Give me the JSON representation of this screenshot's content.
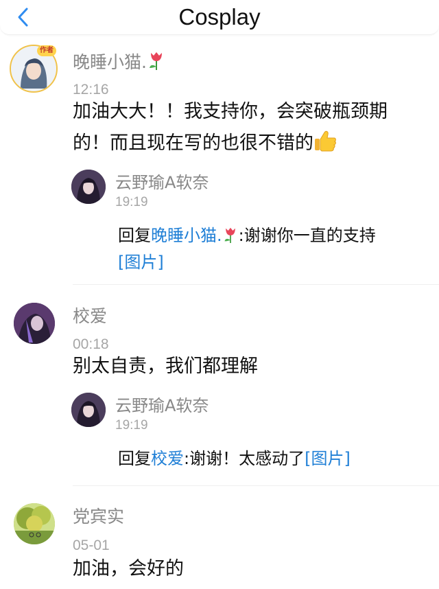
{
  "header": {
    "title": "Cosplay",
    "back_icon": "chevron-left-icon",
    "accent": "#2f8cf0"
  },
  "colors": {
    "link": "#1f7fd6",
    "username": "#888888",
    "time": "#a6a6a6",
    "text": "#111111"
  },
  "comments": [
    {
      "username": "晚睡小猫.",
      "username_emoji": "tulip-icon",
      "author_badge": "作者",
      "time": "12:16",
      "text": "加油大大！！我支持你，会突破瓶颈期的！而且现在写的也很不错的",
      "text_emoji": "thumbs-up-icon",
      "reply": {
        "username": "云野瑜A软奈",
        "time": "19:19",
        "prefix": "回复",
        "target": "晚睡小猫.",
        "target_emoji": "tulip-icon",
        "text": ":谢谢你一直的支持",
        "link": "[图片]"
      }
    },
    {
      "username": "校爱",
      "time": "00:18",
      "text": "别太自责，我们都理解",
      "reply": {
        "username": "云野瑜A软奈",
        "time": "19:19",
        "prefix": "回复",
        "target": "校爱",
        "text": ":谢谢！太感动了",
        "link": "[图片]"
      }
    },
    {
      "username": "党宾实",
      "time": "05-01",
      "text": "加油，会好的"
    }
  ]
}
